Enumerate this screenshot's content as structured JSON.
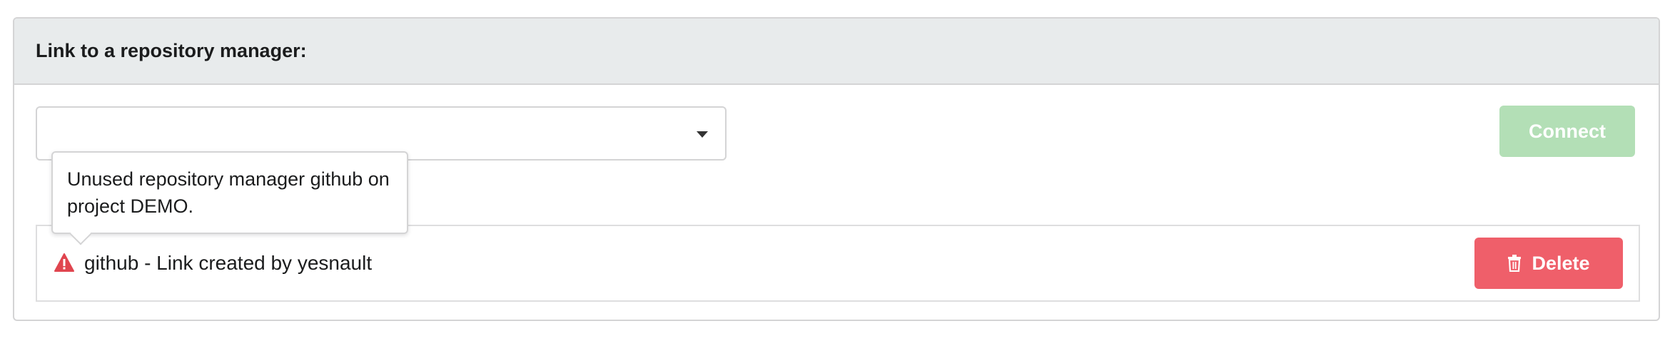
{
  "panel": {
    "title": "Link to a repository manager:"
  },
  "repo_manager_select": {
    "selected_value": ""
  },
  "connect_button": {
    "label": "Connect",
    "state": "disabled",
    "color": "#b3dfb6"
  },
  "links": [
    {
      "warning_icon": "warning-triangle-icon",
      "text": "github - Link created by yesnault",
      "delete_label": "Delete",
      "delete_icon": "trash-icon",
      "delete_color": "#ef5f6a"
    }
  ],
  "tooltip": {
    "text": "Unused repository manager github on project DEMO."
  },
  "colors": {
    "header_bg": "#e8ebec",
    "warning": "#e0454f"
  }
}
